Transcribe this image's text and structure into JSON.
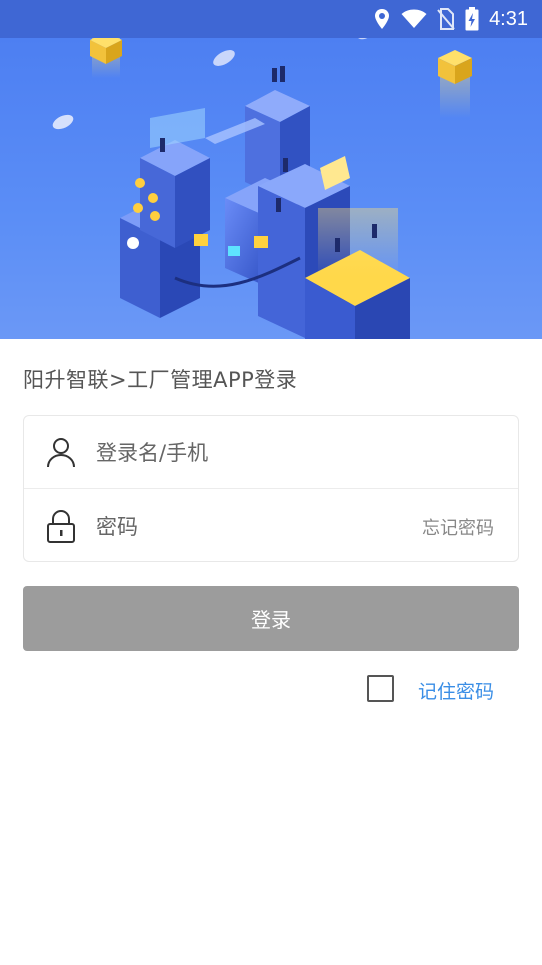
{
  "status_bar": {
    "time": "4:31",
    "icons": [
      "location-icon",
      "wifi-icon",
      "no-sim-icon",
      "battery-charging-icon"
    ],
    "background": "#3f67d4"
  },
  "banner": {
    "illustration": "isometric-data-center-illustration",
    "background": "#5b8ef6"
  },
  "title": "阳升智联>工厂管理APP登录",
  "login_form": {
    "username": {
      "icon": "user-icon",
      "value": "",
      "placeholder": "登录名/手机"
    },
    "password": {
      "icon": "lock-icon",
      "value": "",
      "placeholder": "密码",
      "forgot_label": "忘记密码"
    },
    "submit_label": "登录",
    "submit_color": "#9c9c9c"
  },
  "remember": {
    "checked": false,
    "label": "记住密码",
    "label_color": "#3a8ee6"
  }
}
